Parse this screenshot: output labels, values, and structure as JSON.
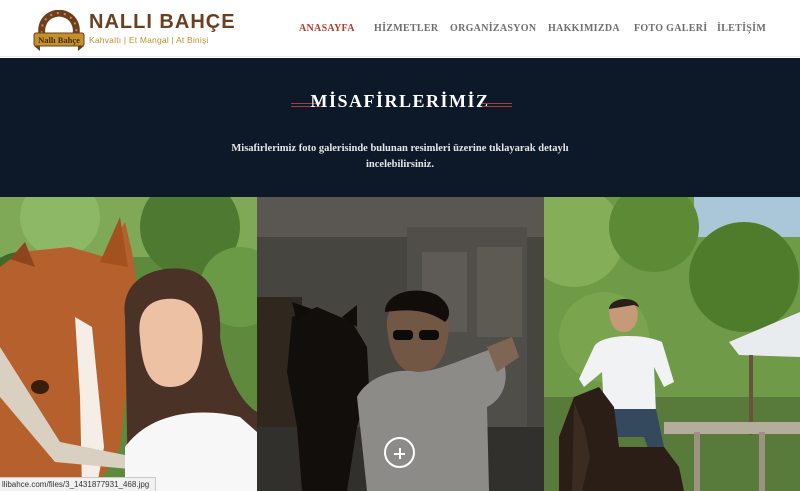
{
  "brand": {
    "name": "NALLI BAHÇE",
    "tagline": "Kahvaltı   |   Et Mangal   |   At Binişi",
    "badge_text": "Nallı Bahçe",
    "colors": {
      "brown": "#6b3f1f",
      "gold": "#c2902c"
    }
  },
  "nav": {
    "items": [
      {
        "label": "ANASAYFA",
        "active": true
      },
      {
        "label": "HİZMETLER",
        "active": false
      },
      {
        "label": "ORGANİZASYON",
        "active": false
      },
      {
        "label": "HAKKIMIZDA",
        "active": false
      },
      {
        "label": "FOTO GALERİ",
        "active": false
      },
      {
        "label": "İLETİŞİM",
        "active": false
      }
    ],
    "active_color": "#b23a2e",
    "color": "#6e6e6e"
  },
  "hero": {
    "title": "MİSAFİRLERİMİZ",
    "description": "Misafirlerimiz foto galerisinde bulunan resimleri üzerine tıklayarak detaylı incelebilirsiniz.",
    "background": "#0d1928",
    "accent": "#b23a2e"
  },
  "gallery": {
    "photos": [
      {
        "subject": "woman-with-horse-photo"
      },
      {
        "subject": "man-with-horse-in-stable-photo",
        "hovered": true
      },
      {
        "subject": "man-riding-horse-photo"
      }
    ],
    "zoom_icon": "plus-circle-icon"
  },
  "statusbar": {
    "url": "llibahce.com/files/3_1431877931_468.jpg"
  }
}
